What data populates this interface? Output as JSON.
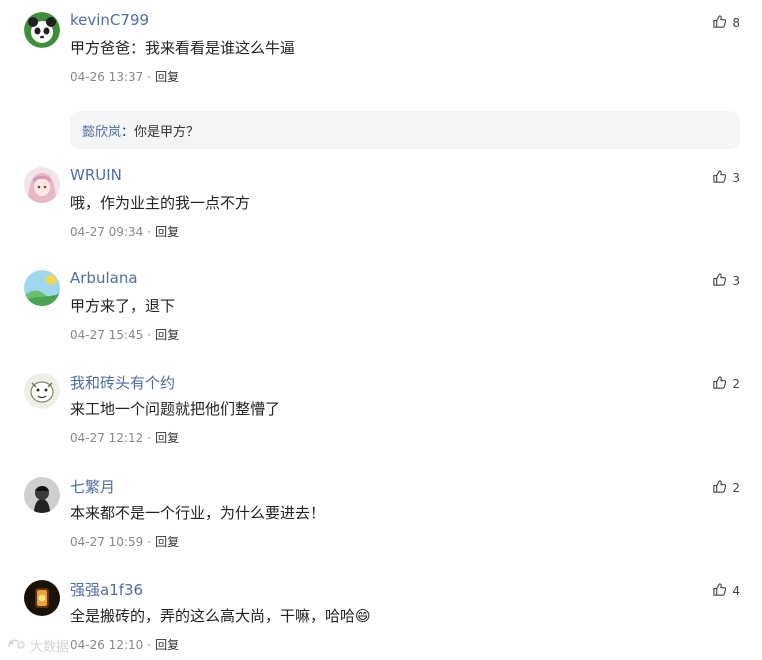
{
  "comments": [
    {
      "user": "kevinC799",
      "text": "甲方爸爸：我来看看是谁这么牛逼",
      "time": "04-26 13:37",
      "reply": "回复",
      "likes": "8",
      "subreply": {
        "name": "懿欣岚",
        "text": "：你是甲方？"
      }
    },
    {
      "user": "WRUIN",
      "text": "哦，作为业主的我一点不方",
      "time": "04-27 09:34",
      "reply": "回复",
      "likes": "3"
    },
    {
      "user": "Arbulana",
      "text": "甲方来了，退下",
      "time": "04-27 15:45",
      "reply": "回复",
      "likes": "3"
    },
    {
      "user": "我和砖头有个约",
      "text": "来工地一个问题就把他们整懵了",
      "time": "04-27 12:12",
      "reply": "回复",
      "likes": "2"
    },
    {
      "user": "七繁月",
      "text": "本来都不是一个行业，为什么要进去！",
      "time": "04-27 10:59",
      "reply": "回复",
      "likes": "2"
    },
    {
      "user": "强强a1f36",
      "text": "全是搬砖的，弄的这么高大尚，干嘛，哈哈",
      "time": "04-26 12:10",
      "reply": "回复",
      "likes": "4",
      "emoji": "😄"
    }
  ],
  "watermark": "大数据"
}
